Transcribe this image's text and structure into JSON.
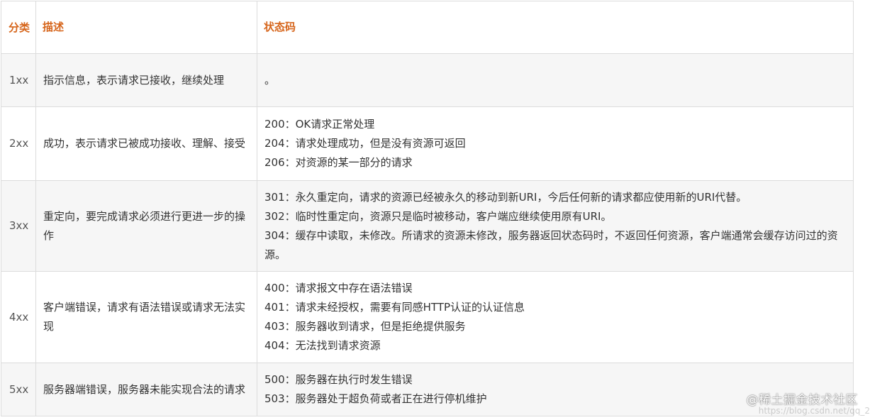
{
  "headers": {
    "category": "分类",
    "description": "描述",
    "codes": "状态码"
  },
  "rows": [
    {
      "category": "1xx",
      "description": "指示信息，表示请求已接收，继续处理",
      "codes": [
        "。"
      ]
    },
    {
      "category": "2xx",
      "description": "成功，表示请求已被成功接收、理解、接受",
      "codes": [
        "200：OK请求正常处理",
        "204：请求处理成功，但是没有资源可返回",
        "206：对资源的某一部分的请求"
      ]
    },
    {
      "category": "3xx",
      "description": "重定向，要完成请求必须进行更进一步的操作",
      "codes": [
        "301：永久重定向，请求的资源已经被永久的移动到新URI，今后任何新的请求都应使用新的URI代替。",
        "302：临时性重定向，资源只是临时被移动，客户端应继续使用原有URI。",
        "304：缓存中读取，未修改。所请求的资源未修改，服务器返回状态码时，不返回任何资源，客户端通常会缓存访问过的资源。"
      ]
    },
    {
      "category": "4xx",
      "description": "客户端错误，请求有语法错误或请求无法实现",
      "codes": [
        "400：请求报文中存在语法错误",
        "401：请求未经授权，需要有同感HTTP认证的认证信息",
        "403：服务器收到请求，但是拒绝提供服务",
        "404：无法找到请求资源"
      ]
    },
    {
      "category": "5xx",
      "description": "服务器端错误，服务器未能实现合法的请求",
      "codes": [
        "500：服务器在执行时发生错误",
        "503：服务器处于超负荷或者正在进行停机维护"
      ]
    }
  ],
  "watermark": {
    "text": "@稀土掘金技术社区",
    "url": "https://blog.csdn.net/qq_2"
  },
  "colors": {
    "header_text": "#d6651b",
    "border": "#dcdcdc",
    "stripe": "#f6f6f6"
  }
}
